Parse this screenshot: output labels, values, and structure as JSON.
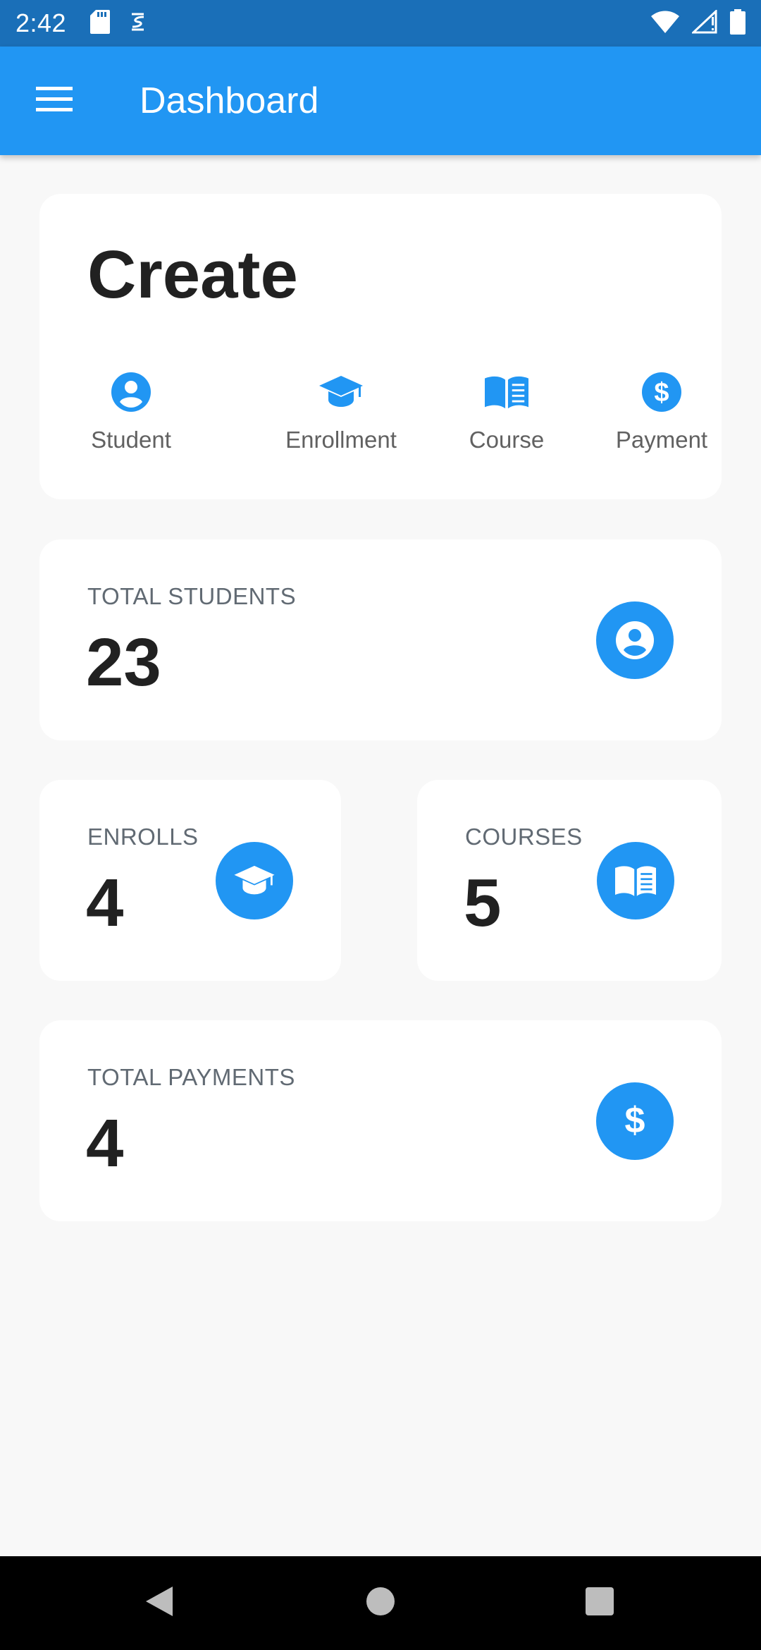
{
  "status_bar": {
    "time": "2:42",
    "left_icons": [
      "sd-card-icon",
      "sync-icon"
    ],
    "right_icons": [
      "wifi-icon",
      "cell-signal-icon",
      "battery-icon"
    ]
  },
  "app_bar": {
    "title": "Dashboard",
    "menu_icon": "menu-icon"
  },
  "create_card": {
    "title": "Create",
    "actions": [
      {
        "label": "Student",
        "icon": "account-circle-icon"
      },
      {
        "label": "Enrollment",
        "icon": "graduation-cap-icon"
      },
      {
        "label": "Course",
        "icon": "book-open-icon"
      },
      {
        "label": "Payment",
        "icon": "dollar-circle-icon"
      }
    ]
  },
  "stats": {
    "students": {
      "label": "TOTAL STUDENTS",
      "value": "23",
      "icon": "account-circle-icon"
    },
    "enrolls": {
      "label": "ENROLLS",
      "value": "4",
      "icon": "graduation-cap-icon"
    },
    "courses": {
      "label": "COURSES",
      "value": "5",
      "icon": "book-open-icon"
    },
    "payments": {
      "label": "TOTAL PAYMENTS",
      "value": "4",
      "icon": "dollar-icon"
    }
  },
  "nav_bar": {
    "buttons": [
      "back-icon",
      "home-icon",
      "recents-icon"
    ]
  },
  "colors": {
    "status_bar": "#1a6fb8",
    "app_bar": "#2196f3",
    "accent": "#2196f3",
    "background": "#f8f8f8",
    "card": "#ffffff"
  }
}
